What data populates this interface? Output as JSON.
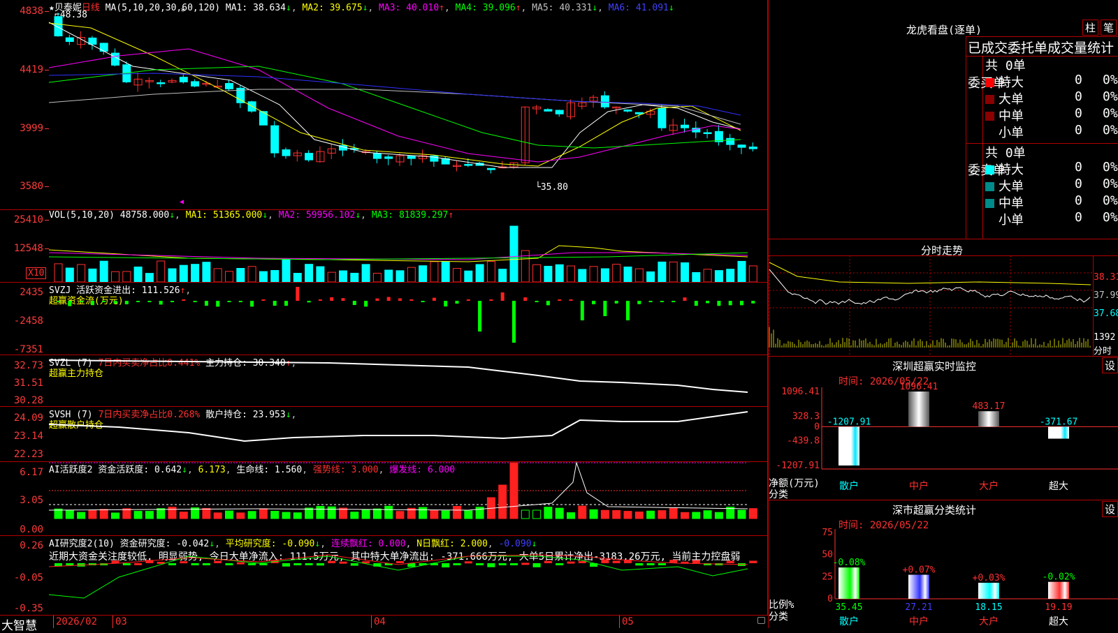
{
  "main": {
    "stock_name": "贝泰妮",
    "period": "日线",
    "ma_label": "MA(5,10,20,30,60,120)",
    "ma1": "MA1: 38.634",
    "ma2": "MA2: 39.675",
    "ma3": "MA3: 40.010",
    "ma4": "MA4: 39.096",
    "ma5": "MA5: 40.331",
    "ma6": "MA6: 41.091",
    "high_mark": "48.38",
    "low_mark": "35.80",
    "y_ticks": [
      "4838",
      "4419",
      "3999",
      "3580"
    ]
  },
  "vol": {
    "label": "VOL(5,10,20)",
    "value": "48758.000",
    "ma1": "MA1: 51365.000",
    "ma2": "MA2: 59956.102",
    "ma3": "MA3: 81839.297",
    "y_ticks": [
      "25410",
      "12548"
    ],
    "unit": "X10"
  },
  "svzj": {
    "label": "SVZJ",
    "text": "活跃资金进出: 111.526",
    "sub": "超赢资金流(万元)",
    "y_ticks": [
      "2435",
      "-2458",
      "-7351"
    ]
  },
  "svzl": {
    "label": "SVZL (7)",
    "pct": "7日内买卖净占比0.441%",
    "hold": "主力持仓: 30.340",
    "sub": "超赢主力持仓",
    "y_ticks": [
      "32.73",
      "31.51",
      "30.28"
    ]
  },
  "svsh": {
    "label": "SVSH (7)",
    "pct": "7日内买卖净占比0.268%",
    "hold": "散户持仓: 23.953",
    "sub": "超赢散户持仓",
    "y_ticks": [
      "24.09",
      "23.14",
      "22.23"
    ]
  },
  "ai1": {
    "label": "AI活跃度2",
    "act": "资金活跃度: 0.642",
    "v2": "6.173",
    "life": "生命线: 1.560",
    "strong": "强势线: 3.000",
    "burst": "爆发线: 6.000",
    "y_ticks": [
      "6.17",
      "3.05",
      "0.00"
    ]
  },
  "ai2": {
    "label": "AI研究度2(10)",
    "res": "资金研究度: -0.042",
    "avg": "平均研究度: -0.090",
    "red": "连续飘红: 0.000",
    "nred": "N日飘红: 2.000",
    "last": "-0.090",
    "comment": "近期大资金关注度较低, 明显弱势, 今日大单净流入: 111.5万元, 其中特大单净流出: -371.666万元, 大单5日累计净出-3183.26万元, 当前主力控盘弱",
    "y_ticks": [
      "0.26",
      "-0.05",
      "-0.35"
    ]
  },
  "xaxis": {
    "labels": [
      "2026/02",
      "03",
      "04",
      "05"
    ],
    "brand": "大智慧"
  },
  "right": {
    "title": "龙虎看盘(逐单)",
    "btn_zhu": "柱",
    "btn_bi": "笔",
    "stat_title": "已成交委托单成交量统计",
    "buy_side": "委买单",
    "sell_side": "委卖单",
    "buy_total": "共 0单",
    "sell_total": "共 0单",
    "rows": [
      {
        "name": "特大",
        "val": "0",
        "pct": "0%"
      },
      {
        "name": "大单",
        "val": "0",
        "pct": "0%"
      },
      {
        "name": "中单",
        "val": "0",
        "pct": "0%"
      },
      {
        "name": "小单",
        "val": "0",
        "pct": "0%"
      }
    ],
    "sell_rows": [
      {
        "name": "特大",
        "val": "0",
        "pct": "0%"
      },
      {
        "name": "大单",
        "val": "0",
        "pct": "0%"
      },
      {
        "name": "中单",
        "val": "0",
        "pct": "0%"
      },
      {
        "name": "小单",
        "val": "0",
        "pct": "0%"
      }
    ],
    "intraday_title": "分时走势",
    "intraday_ticks": [
      "38.31",
      "37.99",
      "37.68"
    ],
    "intraday_vol": "1392",
    "intraday_unit": "分时",
    "monitor_title": "深圳超赢实时监控",
    "set": "设",
    "time": "时间: 2026/05/22",
    "mon_ticks": [
      "1096.41",
      "328.3",
      "0",
      "-439.8",
      "-1207.91"
    ],
    "mon_values": [
      "-1207.91",
      "1096.41",
      "483.17",
      "-371.67"
    ],
    "mon_axis": "净额(万元)",
    "mon_cat": "分类",
    "cats": [
      "散户",
      "中户",
      "大户",
      "超大"
    ],
    "class_title": "深市超赢分类统计",
    "class_time": "时间: 2026/05/22",
    "class_ticks": [
      "75",
      "50",
      "25",
      "0"
    ],
    "class_changes": [
      "-0.08%",
      "+0.07%",
      "+0.03%",
      "-0.02%"
    ],
    "class_values": [
      "35.45",
      "27.21",
      "18.15",
      "19.19"
    ],
    "class_axis": "比例%",
    "class_cat": "分类"
  },
  "chart_data": [
    {
      "type": "bar",
      "title": "深圳超赢实时监控",
      "ylabel": "净额(万元)",
      "categories": [
        "散户",
        "中户",
        "大户",
        "超大"
      ],
      "values": [
        -1207.91,
        1096.41,
        483.17,
        -371.67
      ],
      "ylim": [
        -1207.91,
        1096.41
      ]
    },
    {
      "type": "bar",
      "title": "深市超赢分类统计",
      "ylabel": "比例%",
      "categories": [
        "散户",
        "中户",
        "大户",
        "超大"
      ],
      "values": [
        35.45,
        27.21,
        18.15,
        19.19
      ],
      "changes": [
        -0.08,
        0.07,
        0.03,
        -0.02
      ],
      "ylim": [
        0,
        75
      ]
    }
  ],
  "colors": {
    "up": "#ff3030",
    "down": "#00ffff",
    "grid": "#b40000",
    "ma1": "#ffffff",
    "ma2": "#ffff00",
    "ma3": "#ff00ff",
    "ma4": "#00ff00",
    "ma5": "#c0c0c0",
    "ma6": "#3030ff"
  }
}
